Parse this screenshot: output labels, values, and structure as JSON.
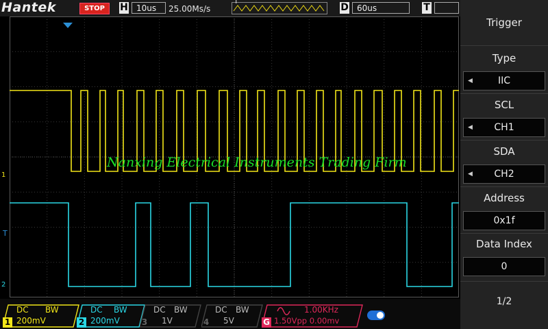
{
  "topbar": {
    "brand": "Hantek",
    "run_state": "STOP",
    "timebase_key": "H",
    "timebase": "10us",
    "sample_rate": "25.00Ms/s",
    "delay_key": "D",
    "delay": "60us",
    "trigger_key": "T",
    "trigger_marker": "T"
  },
  "watermark": "Nanxing Electrical Instruments Trading Firm",
  "menu": {
    "title": "Trigger",
    "type_label": "Type",
    "type_value": "IIC",
    "scl_label": "SCL",
    "scl_value": "CH1",
    "sda_label": "SDA",
    "sda_value": "CH2",
    "address_label": "Address",
    "address_value": "0x1f",
    "data_index_label": "Data Index",
    "data_index_value": "0",
    "page": "1/2"
  },
  "channels": [
    {
      "num": "1",
      "coupling": "DC",
      "bw": "BW",
      "scale": "200mV",
      "color": "#f2e619"
    },
    {
      "num": "2",
      "coupling": "DC",
      "bw": "BW",
      "scale": "200mV",
      "color": "#2ad8e6"
    },
    {
      "num": "3",
      "coupling": "DC",
      "bw": "BW",
      "scale": "1V",
      "color": "#777777"
    },
    {
      "num": "4",
      "coupling": "DC",
      "bw": "BW",
      "scale": "5V",
      "color": "#777777"
    }
  ],
  "generator": {
    "key": "G",
    "frequency": "1.00KHz",
    "amplitude_offset": "1.50Vpp 0.00mv",
    "color": "#e0285a"
  },
  "markers": {
    "ch1": "1",
    "ch2": "2",
    "trigger_level": "T"
  },
  "colors": {
    "ch1": "#f2e619",
    "ch2": "#2ad8e6",
    "trigger": "#2b8fd6",
    "watermark": "#19e028"
  }
}
